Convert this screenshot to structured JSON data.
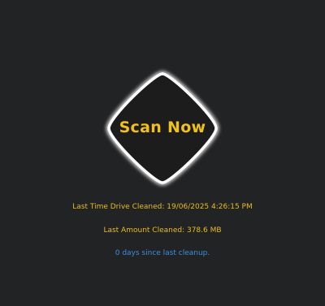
{
  "scan_button": {
    "label": "Scan Now"
  },
  "info": {
    "last_time_cleaned": "Last Time Drive Cleaned: 19/06/2025 4:26:15 PM",
    "last_amount_cleaned": "Last Amount Cleaned: 378.6 MB",
    "days_since": "0 days since last cleanup."
  },
  "colors": {
    "background": "#222325",
    "accent_yellow": "#F0C01B",
    "link_blue": "#3C8EE0",
    "ring_glow": "#FFFFFF"
  }
}
